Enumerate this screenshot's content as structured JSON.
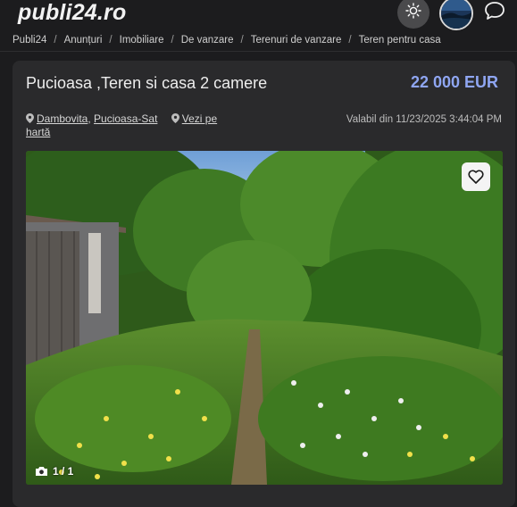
{
  "header": {
    "logo": "publi24.ro",
    "theme_icon": "sun-icon",
    "avatar_icon": "user-avatar",
    "chat_icon": "chat-bubble-icon"
  },
  "breadcrumb": [
    "Publi24",
    "Anunțuri",
    "Imobiliare",
    "De vanzare",
    "Terenuri de vanzare",
    "Teren pentru casa"
  ],
  "listing": {
    "title": "Pucioasa ,Teren si casa 2 camere",
    "price": "22 000 EUR",
    "location_county": "Dambovita",
    "location_city": "Pucioasa-Sat",
    "map_link": "Vezi pe hartă",
    "valid_from": "Valabil din 11/23/2025 3:44:04 PM",
    "photo_count": "1 / 1",
    "favorite_icon": "heart-icon",
    "camera_icon": "camera-icon"
  },
  "colors": {
    "background": "#1c1c1e",
    "card": "#2a2a2c",
    "price": "#8fa6f2"
  }
}
